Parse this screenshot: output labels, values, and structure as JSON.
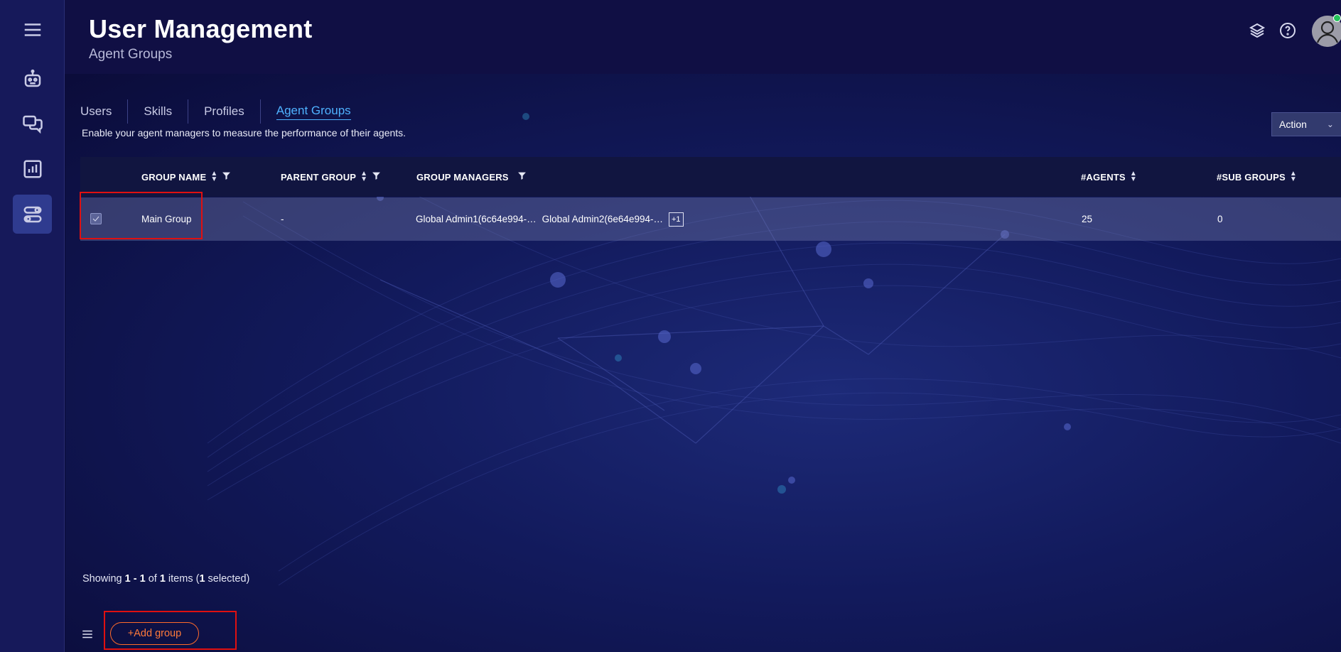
{
  "header": {
    "title": "User Management",
    "subtitle": "Agent Groups"
  },
  "sidebar": {
    "items": [
      {
        "icon": "menu-icon"
      },
      {
        "icon": "robot-icon"
      },
      {
        "icon": "chat-icon"
      },
      {
        "icon": "analytics-icon"
      },
      {
        "icon": "settings-toggle-icon",
        "active": true
      }
    ]
  },
  "tabs": [
    {
      "label": "Users"
    },
    {
      "label": "Skills"
    },
    {
      "label": "Profiles"
    },
    {
      "label": "Agent Groups",
      "active": true
    }
  ],
  "description": "Enable your agent managers to measure the performance of their agents.",
  "action": {
    "label": "Action"
  },
  "table": {
    "columns": {
      "group_name": "GROUP NAME",
      "parent_group": "PARENT GROUP",
      "group_managers": "GROUP MANAGERS",
      "agents": "#AGENTS",
      "sub_groups": "#SUB GROUPS"
    },
    "rows": [
      {
        "checked": true,
        "group_name": "Main Group",
        "parent_group": "-",
        "manager_1": "Global Admin1(6c64e994-…",
        "manager_2": "Global Admin2(6e64e994-…",
        "more_managers": "+1",
        "agents": "25",
        "sub_groups": "0"
      }
    ]
  },
  "footer": {
    "showing_prefix": "Showing ",
    "range": "1 - 1",
    "of_text": " of ",
    "total": "1",
    "items_text": " items (",
    "selected": "1",
    "selected_text": " selected)",
    "add_group_label": "+Add group"
  },
  "colors": {
    "accent_tab": "#4fb2ff",
    "add_button": "#ff7a3a",
    "highlight": "#e01010",
    "presence": "#25c25a"
  }
}
